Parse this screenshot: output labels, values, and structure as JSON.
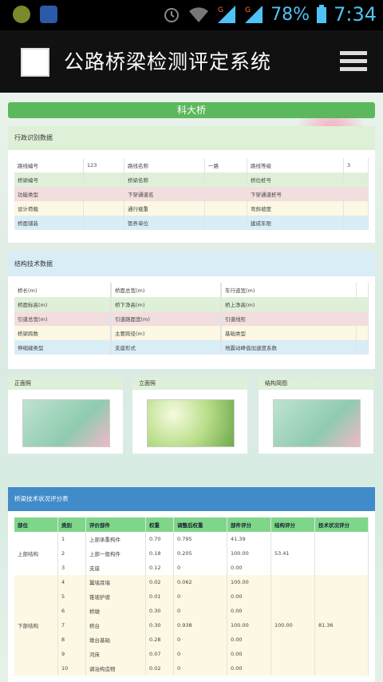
{
  "status": {
    "battery": "78%",
    "time": "7:34"
  },
  "app": {
    "title": "公路桥梁检测评定系统"
  },
  "bridge": {
    "name": "科大桥"
  },
  "admin": {
    "header": "行政识别数据",
    "rows": [
      [
        "路线编号",
        "123",
        "路线名称",
        "一路",
        "路线等级",
        "3"
      ],
      [
        "桥梁编号",
        "",
        "桥梁名称",
        "",
        "桥位桩号",
        ""
      ],
      [
        "功能类型",
        "",
        "下穿通道名",
        "",
        "下穿通道桩号",
        ""
      ],
      [
        "设计荷载",
        "",
        "通行载重",
        "",
        "弯斜坡度",
        ""
      ],
      [
        "桥面铺装",
        "",
        "管养单位",
        "",
        "建成年限",
        ""
      ]
    ]
  },
  "struct": {
    "header": "结构技术数据",
    "rows": [
      [
        "桥长(m)",
        "",
        "桥面总宽(m)",
        "",
        "车行道宽(m)",
        ""
      ],
      [
        "桥面标高(m)",
        "",
        "桥下净高(m)",
        "",
        "桥上净高(m)",
        ""
      ],
      [
        "引道总宽(m)",
        "",
        "引道路面宽(m)",
        "",
        "引道线形",
        ""
      ],
      [
        "桥梁跨数",
        "",
        "主要跨径(m)",
        "",
        "基础类型",
        ""
      ],
      [
        "伸缩缝类型",
        "",
        "支座形式",
        "",
        "地震动峰值加速度系数",
        ""
      ]
    ]
  },
  "photos": {
    "front": "正面照",
    "elevation": "立面照",
    "sketch": "结构简图"
  },
  "score": {
    "header": "桥梁技术状况评分表",
    "columns": [
      "部位",
      "类别",
      "评价部件",
      "权重",
      "调整后权重",
      "部件评分",
      "结构评分",
      "技术状况评分"
    ],
    "rows": [
      [
        "",
        "1",
        "上部承重构件",
        "0.70",
        "0.795",
        "41.39",
        "",
        ""
      ],
      [
        "上部结构",
        "2",
        "上部一般构件",
        "0.18",
        "0.205",
        "100.00",
        "53.41",
        ""
      ],
      [
        "",
        "3",
        "支座",
        "0.12",
        "0",
        "0.00",
        "",
        ""
      ],
      [
        "",
        "4",
        "翼墙耳墙",
        "0.02",
        "0.062",
        "100.00",
        "",
        ""
      ],
      [
        "",
        "5",
        "锥坡护坡",
        "0.01",
        "0",
        "0.00",
        "",
        ""
      ],
      [
        "",
        "6",
        "桥墩",
        "0.30",
        "0",
        "0.00",
        "",
        ""
      ],
      [
        "下部结构",
        "7",
        "桥台",
        "0.30",
        "0.938",
        "100.00",
        "100.00",
        "81.36"
      ],
      [
        "",
        "8",
        "墩台基础",
        "0.28",
        "0",
        "0.00",
        "",
        ""
      ],
      [
        "",
        "9",
        "河床",
        "0.07",
        "0",
        "0.00",
        "",
        ""
      ],
      [
        "",
        "10",
        "调治构造物",
        "0.02",
        "0",
        "0.00",
        "",
        ""
      ]
    ]
  }
}
